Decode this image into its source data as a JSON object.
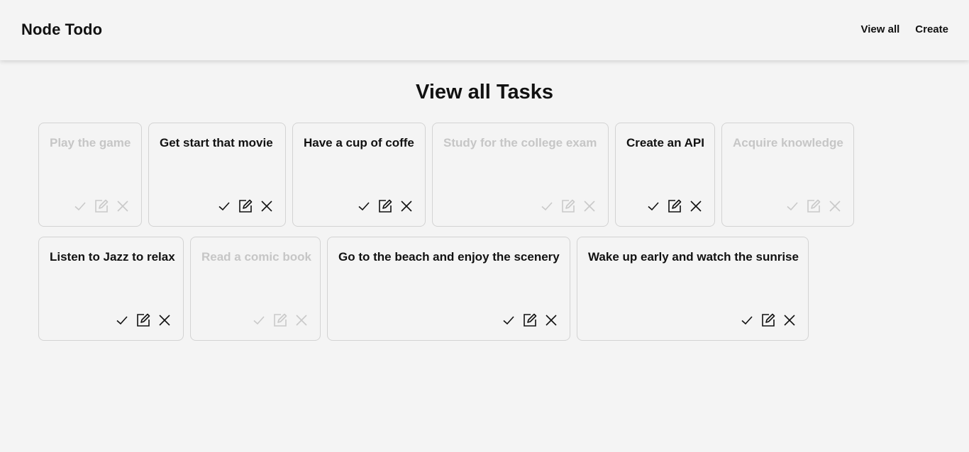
{
  "navbar": {
    "brand": "Node Todo",
    "links": [
      {
        "label": "View all"
      },
      {
        "label": "Create"
      }
    ]
  },
  "page": {
    "title": "View all Tasks"
  },
  "tasks": [
    {
      "title": "Play the game",
      "completed": true
    },
    {
      "title": "Get start that movie",
      "completed": false
    },
    {
      "title": "Have a cup of coffe",
      "completed": false
    },
    {
      "title": "Study for the college exam",
      "completed": true
    },
    {
      "title": "Create an API",
      "completed": false
    },
    {
      "title": "Acquire knowledge",
      "completed": true
    },
    {
      "title": "Listen to Jazz to relax",
      "completed": false
    },
    {
      "title": "Read a comic book",
      "completed": true
    },
    {
      "title": "Go to the beach and enjoy the scenery",
      "completed": false
    },
    {
      "title": "Wake up early and watch the sunrise",
      "completed": false
    }
  ],
  "icons": {
    "complete": "check-icon",
    "edit": "edit-icon",
    "delete": "close-icon"
  },
  "colors": {
    "background": "#f4f4f4",
    "text": "#111111",
    "completed_text": "#c6c6c6",
    "card_border": "#d3d3d3"
  }
}
